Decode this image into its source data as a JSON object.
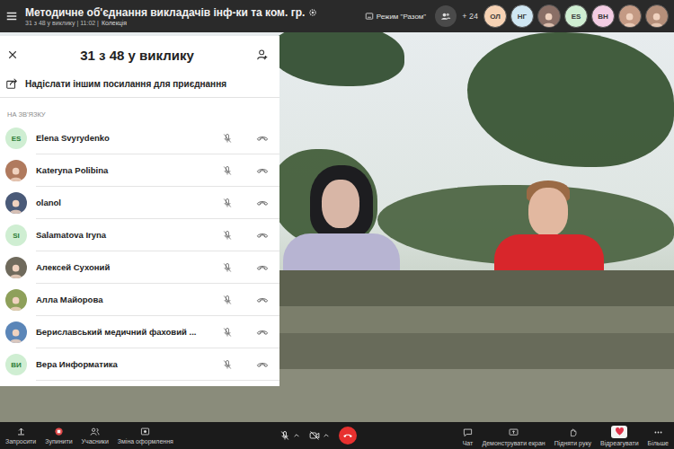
{
  "window": {
    "title": "Методичне об'єднання викладачів інф-ки та ком. гр.",
    "subtitle": "31 з 48 у виклику | 11:02 |",
    "subtitle_link": "Колекція"
  },
  "header": {
    "mode_button": "Режим \"Разом\"",
    "extra_count": "+ 24",
    "avatars": [
      {
        "kind": "initials",
        "initials": "ОЛ",
        "color": "#f6d2b4"
      },
      {
        "kind": "initials",
        "initials": "НГ",
        "color": "#cfe6f2"
      },
      {
        "kind": "photo",
        "initials": "",
        "color": "#8a6f66"
      },
      {
        "kind": "initials",
        "initials": "ES",
        "color": "#cfeed2"
      },
      {
        "kind": "initials",
        "initials": "ВН",
        "color": "#f3cde3"
      },
      {
        "kind": "photo",
        "initials": "",
        "color": "#c49a84"
      },
      {
        "kind": "photo",
        "initials": "",
        "color": "#b58f7a"
      }
    ]
  },
  "participants_panel": {
    "title": "31 з 48 у виклику",
    "invite_link": "Надіслати іншим посилання для приєднання",
    "section": "НА ЗВ'ЯЗКУ",
    "participants": [
      {
        "name": "Elena Svyrydenko",
        "kind": "initials",
        "initials": "ES",
        "color": "#cfeed2",
        "muted": true
      },
      {
        "name": "Kateryna Polibina",
        "kind": "photo",
        "initials": "",
        "color": "#b07a5e",
        "muted": true
      },
      {
        "name": "olanol",
        "kind": "photo",
        "initials": "",
        "color": "#4a5a78",
        "muted": true
      },
      {
        "name": "Salamatova Iryna",
        "kind": "initials",
        "initials": "SI",
        "color": "#cfeed2",
        "muted": true
      },
      {
        "name": "Алексей Сухоний",
        "kind": "photo",
        "initials": "",
        "color": "#6f6a5c",
        "muted": true
      },
      {
        "name": "Алла Майорова",
        "kind": "photo",
        "initials": "",
        "color": "#8ea05a",
        "muted": true
      },
      {
        "name": "Бериславський медичний фаховий ...",
        "kind": "photo",
        "initials": "",
        "color": "#5b86b8",
        "muted": true
      },
      {
        "name": "Вера Информатика",
        "kind": "initials",
        "initials": "ВИ",
        "color": "#cfeed2",
        "muted": true
      }
    ]
  },
  "toolbar": {
    "left": [
      {
        "kind": "invite",
        "label": "Запросити"
      },
      {
        "kind": "stop",
        "label": "Зупинити"
      },
      {
        "kind": "participants",
        "label": "Учасники"
      },
      {
        "kind": "effects",
        "label": "Зміна оформлення"
      }
    ],
    "mic": {
      "on": false
    },
    "video": {
      "on": false
    },
    "right": [
      {
        "kind": "chat",
        "label": "Чат"
      },
      {
        "kind": "share",
        "label": "Демонструвати екран"
      },
      {
        "kind": "hand",
        "label": "Підняти руку"
      },
      {
        "kind": "react",
        "label": "Відреагувати"
      },
      {
        "kind": "more",
        "label": "Більше"
      }
    ]
  }
}
